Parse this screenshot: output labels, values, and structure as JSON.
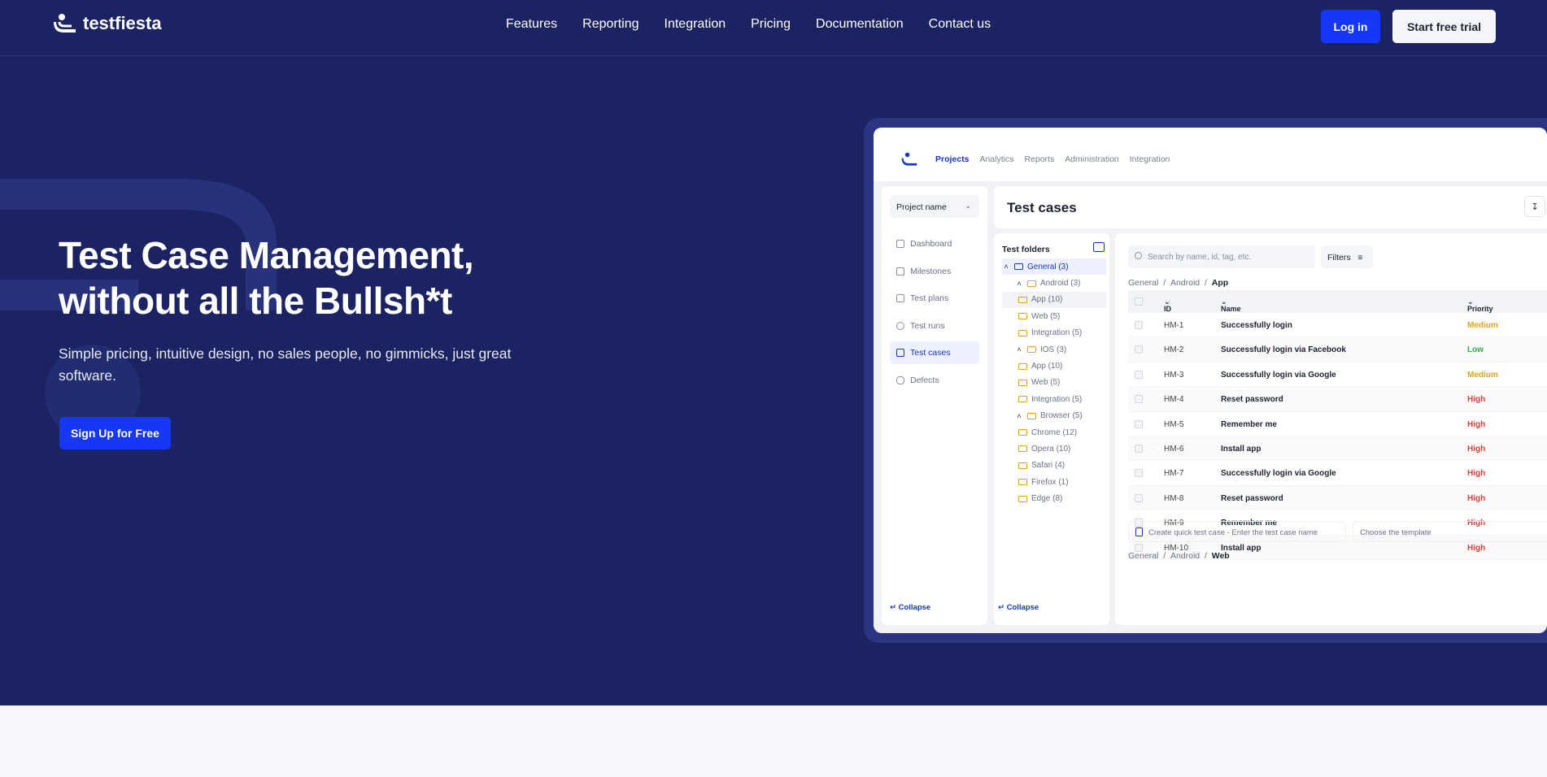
{
  "brand": {
    "name": "testfiesta"
  },
  "nav": {
    "links": [
      "Features",
      "Reporting",
      "Integration",
      "Pricing",
      "Documentation",
      "Contact us"
    ],
    "login": "Log in",
    "trial": "Start free trial"
  },
  "hero": {
    "title_line1": "Test Case Management,",
    "title_line2": "without all the Bullsh*t",
    "subtitle": "Simple pricing, intuitive design, no sales people, no gimmicks, just great software.",
    "cta": "Sign Up for Free"
  },
  "app": {
    "tabs": [
      "Projects",
      "Analytics",
      "Reports",
      "Administration",
      "Integration"
    ],
    "project_select": "Project name",
    "sidebar": [
      "Dashboard",
      "Milestones",
      "Test plans",
      "Test runs",
      "Test cases",
      "Defects"
    ],
    "collapse": "Collapse",
    "page_title": "Test cases",
    "folders_title": "Test folders",
    "folders": [
      {
        "label": "General (3)",
        "level": 0,
        "caret": "^",
        "state": "hl"
      },
      {
        "label": "Android (3)",
        "level": 1,
        "caret": "^",
        "state": ""
      },
      {
        "label": "App (10)",
        "level": 2,
        "caret": "",
        "state": "sel"
      },
      {
        "label": "Web (5)",
        "level": 2,
        "caret": "",
        "state": ""
      },
      {
        "label": "Integration (5)",
        "level": 2,
        "caret": "",
        "state": ""
      },
      {
        "label": "IOS (3)",
        "level": 1,
        "caret": "^",
        "state": ""
      },
      {
        "label": "App (10)",
        "level": 2,
        "caret": "",
        "state": ""
      },
      {
        "label": "Web (5)",
        "level": 2,
        "caret": "",
        "state": ""
      },
      {
        "label": "Integration (5)",
        "level": 2,
        "caret": "",
        "state": ""
      },
      {
        "label": "Browser (5)",
        "level": 1,
        "caret": "^",
        "state": ""
      },
      {
        "label": "Chrome (12)",
        "level": 2,
        "caret": "",
        "state": ""
      },
      {
        "label": "Opera (10)",
        "level": 2,
        "caret": "",
        "state": ""
      },
      {
        "label": "Safari (4)",
        "level": 2,
        "caret": "",
        "state": ""
      },
      {
        "label": "Firefox (1)",
        "level": 2,
        "caret": "",
        "state": ""
      },
      {
        "label": "Edge (8)",
        "level": 2,
        "caret": "",
        "state": ""
      }
    ],
    "search_placeholder": "Search by name, id, tag, etc.",
    "filters": "Filters",
    "breadcrumb1": {
      "a": "General",
      "b": "Android",
      "c": "App"
    },
    "breadcrumb2": {
      "a": "General",
      "b": "Android",
      "c": "Web"
    },
    "columns": {
      "id": "ID",
      "name": "Name",
      "priority": "Priority"
    },
    "rows": [
      {
        "id": "HM-1",
        "name": "Successfully login",
        "priority": "Medium"
      },
      {
        "id": "HM-2",
        "name": "Successfully login via Facebook",
        "priority": "Low"
      },
      {
        "id": "HM-3",
        "name": "Successfully login via Google",
        "priority": "Medium"
      },
      {
        "id": "HM-4",
        "name": "Reset password",
        "priority": "High"
      },
      {
        "id": "HM-5",
        "name": "Remember me",
        "priority": "High"
      },
      {
        "id": "HM-6",
        "name": "Install app",
        "priority": "High"
      },
      {
        "id": "HM-7",
        "name": "Successfully login via Google",
        "priority": "High"
      },
      {
        "id": "HM-8",
        "name": "Reset password",
        "priority": "High"
      },
      {
        "id": "HM-9",
        "name": "Remember me",
        "priority": "High"
      },
      {
        "id": "HM-10",
        "name": "Install app",
        "priority": "High"
      }
    ],
    "priority_colors": {
      "High": "#e23b3b",
      "Medium": "#e6a21a",
      "Low": "#2eaa4f"
    },
    "quick_create": "Create quick test case - Enter the test case name",
    "template": "Choose the template"
  }
}
